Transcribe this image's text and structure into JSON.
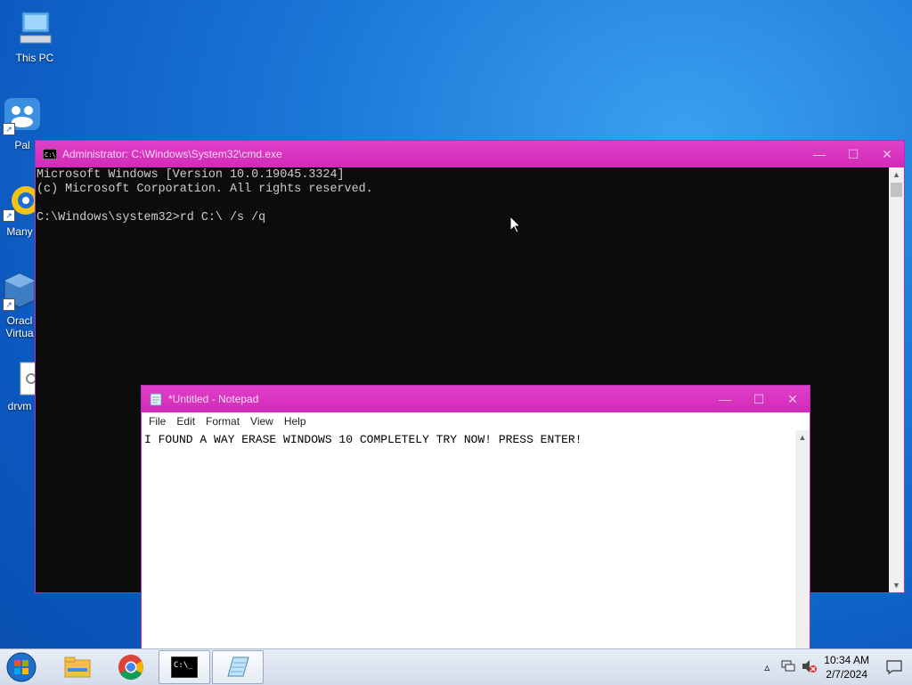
{
  "desktop": {
    "icons": [
      {
        "label": "This PC"
      },
      {
        "label": "Pal"
      },
      {
        "label": "Many"
      },
      {
        "label": "Oracl Virtua"
      },
      {
        "label": "drvm"
      }
    ]
  },
  "cmd": {
    "title": "Administrator: C:\\Windows\\System32\\cmd.exe",
    "lines": [
      "Microsoft Windows [Version 10.0.19045.3324]",
      "(c) Microsoft Corporation. All rights reserved.",
      "",
      "C:\\Windows\\system32>rd C:\\ /s /q"
    ]
  },
  "notepad": {
    "title": "*Untitled - Notepad",
    "menu": [
      "File",
      "Edit",
      "Format",
      "View",
      "Help"
    ],
    "content": "I FOUND A WAY ERASE WINDOWS 10 COMPLETELY TRY NOW! PRESS ENTER!"
  },
  "taskbar": {
    "time": "10:34 AM",
    "date": "2/7/2024"
  },
  "colors": {
    "titlebar_accent": "#d22ab8",
    "desktop_blue": "#1a76d6",
    "console_bg": "#0c0c0c"
  }
}
